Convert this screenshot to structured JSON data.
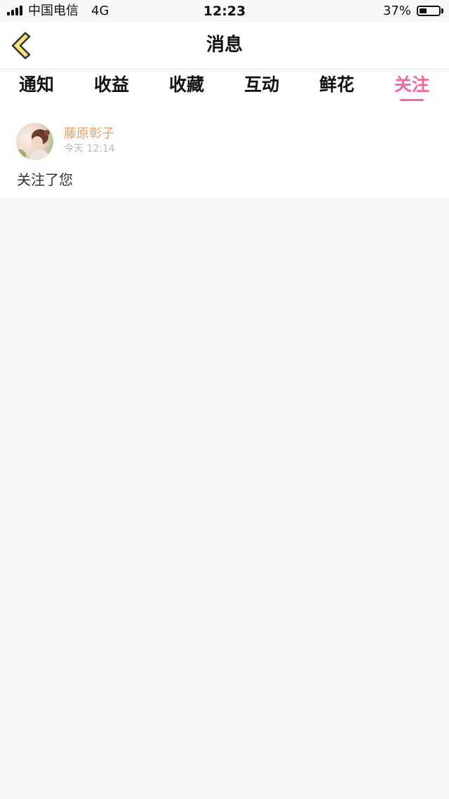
{
  "status_bar": {
    "carrier": "中国电信",
    "network": "4G",
    "time": "12:23",
    "battery_percent": "37%",
    "battery_level": 0.37
  },
  "header": {
    "title": "消息",
    "back_icon": "chevron-left-icon"
  },
  "tabs": [
    {
      "label": "通知",
      "active": false
    },
    {
      "label": "收益",
      "active": false
    },
    {
      "label": "收藏",
      "active": false
    },
    {
      "label": "互动",
      "active": false
    },
    {
      "label": "鲜花",
      "active": false
    },
    {
      "label": "关注",
      "active": true
    }
  ],
  "messages": [
    {
      "sender": "藤原彰子",
      "time": "今天 12:14",
      "text": "关注了您"
    }
  ],
  "colors": {
    "accent": "#f0699e",
    "sender_name": "#e8a06a",
    "back_icon_fill": "#f5e27a",
    "background": "#f9f7f8"
  }
}
